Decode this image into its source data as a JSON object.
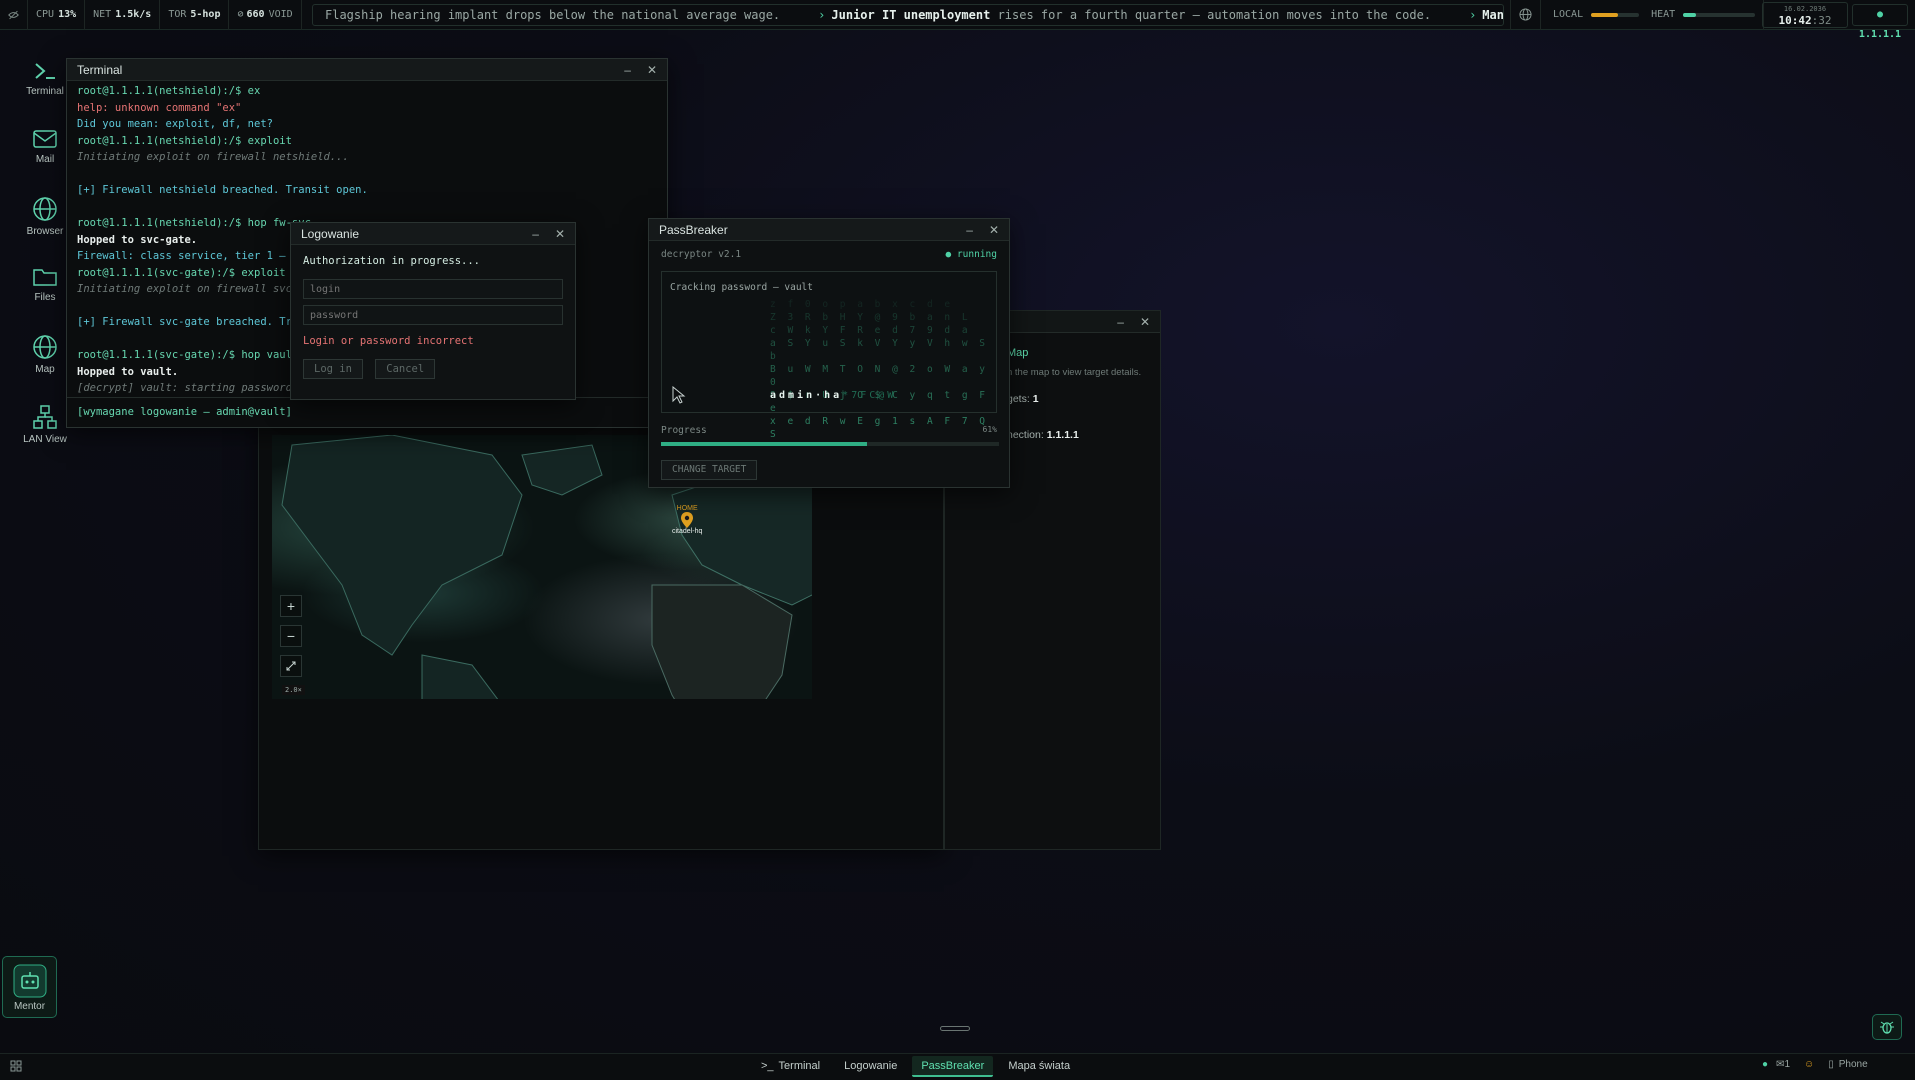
{
  "topbar": {
    "cpu_label": "CPU",
    "cpu_value": "13%",
    "net_label": "NET",
    "net_value": "1.5k/s",
    "tor_label": "TOR",
    "tor_value": "5-hop",
    "void_value": "660",
    "void_label": "VOID",
    "ticker": [
      {
        "head": "",
        "rest": "Flagship hearing implant drops below the national average wage."
      },
      {
        "head": "Junior IT unemployment",
        "rest": "rises for a fourth quarter — automation moves into the code."
      },
      {
        "head": "Man sues implant",
        "rest": "maker"
      }
    ],
    "local_label": "LOCAL",
    "local_level": 0.55,
    "heat_label": "HEAT",
    "heat_level": 0.18,
    "date": "16.02.2036",
    "time_main": "10:42",
    "time_sec": ":32",
    "ip": "1.1.1.1",
    "colors": {
      "accent": "#4fd1a5",
      "warn": "#e0a020",
      "error": "#e57373"
    }
  },
  "dock": [
    {
      "label": "Terminal",
      "icon": "terminal-icon"
    },
    {
      "label": "Mail",
      "icon": "mail-icon"
    },
    {
      "label": "Browser",
      "icon": "globe-icon"
    },
    {
      "label": "Files",
      "icon": "folder-icon"
    },
    {
      "label": "Map",
      "icon": "globe-icon"
    },
    {
      "label": "LAN View",
      "icon": "network-icon"
    }
  ],
  "mentor_label": "Mentor",
  "terminal": {
    "title": "Terminal",
    "lines": [
      {
        "cls": "c-prompt",
        "text": "root@1.1.1.1(netshield):/$ ex"
      },
      {
        "cls": "c-err",
        "text": "help: unknown command \"ex\""
      },
      {
        "cls": "c-info",
        "text": "Did you mean: exploit, df, net?"
      },
      {
        "cls": "c-prompt",
        "text": "root@1.1.1.1(netshield):/$ exploit"
      },
      {
        "cls": "c-dim",
        "text": "Initiating exploit on firewall netshield..."
      },
      {
        "cls": "c-info",
        "text": ""
      },
      {
        "cls": "c-info",
        "text": "[+] Firewall netshield breached. Transit open."
      },
      {
        "cls": "c-info",
        "text": ""
      },
      {
        "cls": "c-prompt",
        "text": "root@1.1.1.1(netshield):/$ hop fw-svc"
      },
      {
        "cls": "c-white",
        "text": "Hopped to svc-gate."
      },
      {
        "cls": "c-info",
        "text": "Firewall: class service, tier 1 — rec"
      },
      {
        "cls": "c-prompt",
        "text": "root@1.1.1.1(svc-gate):/$ exploit"
      },
      {
        "cls": "c-dim",
        "text": "Initiating exploit on firewall svc-ga"
      },
      {
        "cls": "c-info",
        "text": ""
      },
      {
        "cls": "c-info",
        "text": "[+] Firewall svc-gate breached. Trans"
      },
      {
        "cls": "c-info",
        "text": ""
      },
      {
        "cls": "c-prompt",
        "text": "root@1.1.1.1(svc-gate):/$ hop vault"
      },
      {
        "cls": "c-white",
        "text": "Hopped to vault."
      },
      {
        "cls": "c-dim",
        "text": "[decrypt] vault: starting password re"
      }
    ],
    "status_line": "[wymagane logowanie — admin@vault]"
  },
  "login": {
    "title": "Logowanie",
    "status": "Authorization in progress...",
    "login_placeholder": "login",
    "password_placeholder": "password",
    "error": "Login or password incorrect",
    "login_button": "Log in",
    "cancel_button": "Cancel"
  },
  "passbreaker": {
    "title": "PassBreaker",
    "version": "decryptor v2.1",
    "state": "● running",
    "cracking_label": "Cracking password — vault",
    "matrix_rows": [
      "z f 0 o p a b x c d e",
      "Z 3 R b H Y @ 9 b a n L",
      "c W k Y F R e d 7 9 d a",
      "a S Y u S k V Y y V h w S b",
      "B u W M T O N @ 2 o W a y 0",
      "9 $ r U j O $ C y q t g F e",
      "x e d R w E g 1 s A F 7 Q S"
    ],
    "revealed": "admin·ha",
    "revealed_tail": "*7FC@W",
    "progress_label": "Progress",
    "progress_pct": "61%",
    "progress_value": 0.61,
    "change_target": "CHANGE TARGET"
  },
  "map_window": {
    "panel_title": "Map",
    "panel_hint": "n the map to view target details.",
    "targets_label": "gets:",
    "targets_value": "1",
    "connection_label": "nection:",
    "connection_value": "1.1.1.1",
    "home_label": "HOME",
    "node_label": "citadel-hq",
    "zoom_in": "+",
    "zoom_out": "−",
    "zoom_level": "2.0×"
  },
  "taskbar": {
    "tasks": [
      "Terminal",
      "Logowanie",
      "PassBreaker",
      "Mapa świata"
    ],
    "active_index": 2,
    "mail_count": "1",
    "phone_label": "Phone"
  }
}
